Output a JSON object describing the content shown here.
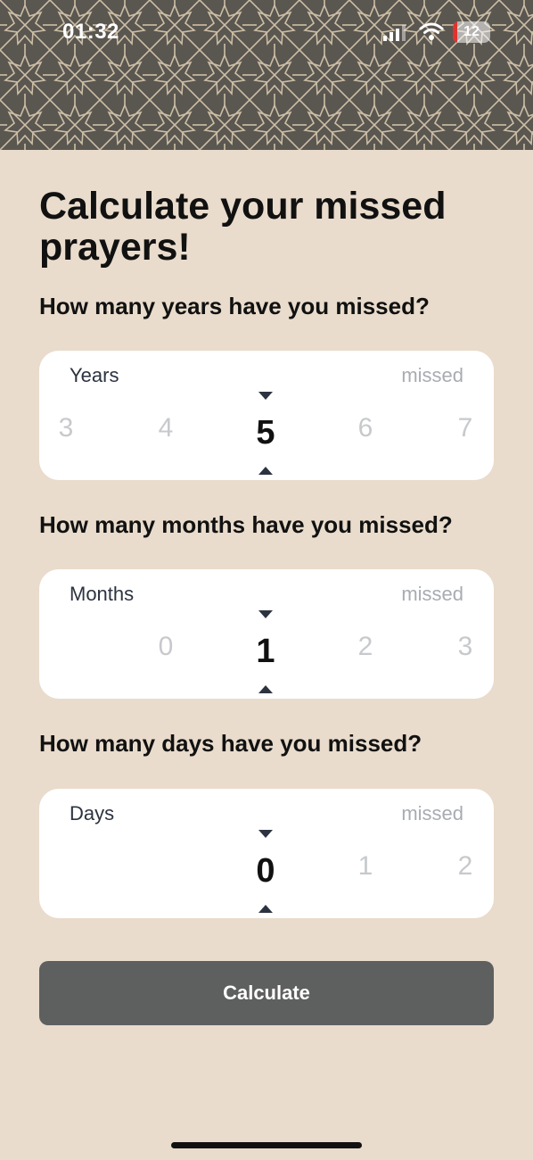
{
  "status_bar": {
    "time": "01:32",
    "battery": "12",
    "battery_level": 0.12,
    "battery_color": "#e0322e"
  },
  "colors": {
    "background": "#e9dccc",
    "header_pattern": "#5a5650",
    "button": "#5e5f5f"
  },
  "title": "Calculate your missed prayers!",
  "years": {
    "question": "How many years have you missed?",
    "label": "Years",
    "suffix": "missed",
    "values": [
      "3",
      "4",
      "5",
      "6",
      "7"
    ],
    "selected": "5"
  },
  "months": {
    "question": "How many months have you missed?",
    "label": "Months",
    "suffix": "missed",
    "values": [
      "",
      "0",
      "1",
      "2",
      "3"
    ],
    "selected": "1"
  },
  "days": {
    "question": "How many days have you missed?",
    "label": "Days",
    "suffix": "missed",
    "values": [
      "",
      "",
      "0",
      "1",
      "2"
    ],
    "selected": "0"
  },
  "calculate_label": "Calculate"
}
